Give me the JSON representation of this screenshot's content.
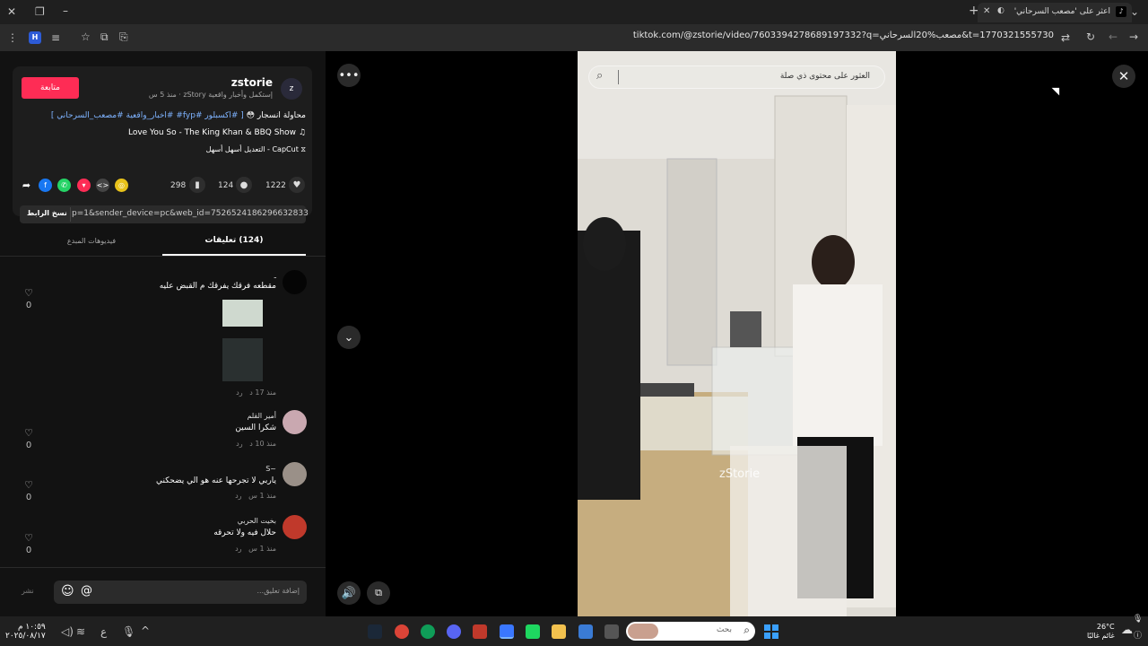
{
  "browser": {
    "tab_title": "اعثر على 'مصعب السرحاني'",
    "url": "tiktok.com/@zstorie/video/7603394278689197332?q=مصعب%20السرحاني&t=1770321555730",
    "profile_initial": "H"
  },
  "post": {
    "follow_label": "متابعة",
    "username": "zstorie",
    "avatar_letter": "z",
    "subtitle": "إستكمل وأخبار واقعية zStory · منذ 5 س",
    "caption_prefix": "محاولة انسجار",
    "caption_emoji": "😳",
    "caption_tags": "[ #اكسبلور #fyp# #اخبار_واقعية #مصعب_السرحاني ]",
    "music": "Love You So - The King Khan & BBQ Show",
    "capcut_label": "CapCut - التعديل أسهل أسهل"
  },
  "stats": {
    "likes": "1222",
    "comments": "124",
    "saves": "298"
  },
  "share": {
    "copy_link_label": "نسخ الرابط",
    "link_text": "p=1&sender_device=pc&web_id=7526524186296632833"
  },
  "tabs": {
    "comments_tab": "(124) تعليقات",
    "creator_videos_tab": "فيديوهات المبدع"
  },
  "comments": [
    {
      "name": "ـ",
      "text": "مقطعه فرقك يفرقك م القبض عليه",
      "time": "منذ 17 د",
      "reply": "رد",
      "likes": "0"
    },
    {
      "name": "أمير القلم",
      "text": "شكرا السين",
      "time": "منذ 10 د",
      "reply": "رد",
      "likes": "0"
    },
    {
      "name": "S~",
      "text": "ياربي لا تجرحها عنه هو الي يضحكني",
      "time": "منذ 1 س",
      "reply": "رد",
      "likes": "0"
    },
    {
      "name": "بخيت الحربي",
      "text": "حلال فيه ولا تحرقه",
      "time": "منذ 1 س",
      "reply": "رد",
      "likes": "0"
    }
  ],
  "comment_input": {
    "placeholder": "إضافة تعليق...",
    "post_label": "نشر"
  },
  "video": {
    "search_placeholder": "العثور على محتوى ذي صلة",
    "watermark": "zStorie"
  },
  "taskbar": {
    "search_placeholder": "بحث",
    "weather_temp": "26°C",
    "weather_desc": "غائم غالبًا",
    "time": "١٠:٥٩ م",
    "date": "٢٠٢٥/٠٨/١٧",
    "lang": "ع"
  },
  "colors": {
    "accent": "#fe2c55",
    "panel_bg": "#121212",
    "hashtag": "#7eb3ff"
  }
}
